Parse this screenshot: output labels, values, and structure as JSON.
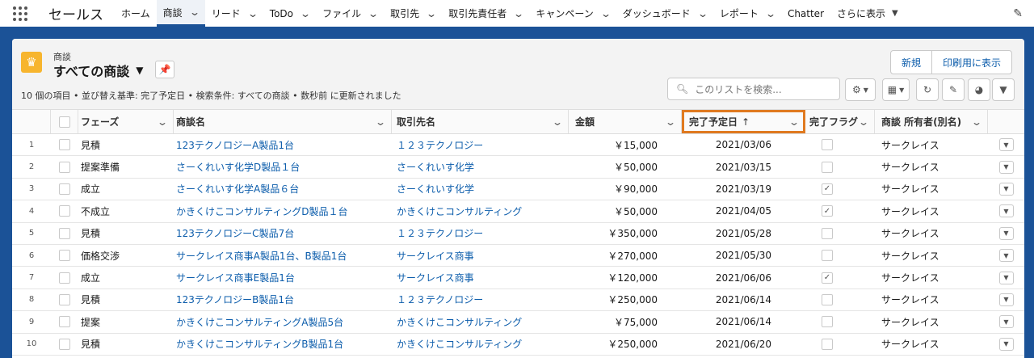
{
  "app": {
    "name": "セールス"
  },
  "nav": {
    "items": [
      {
        "label": "ホーム",
        "chevron": false
      },
      {
        "label": "商談",
        "chevron": true,
        "active": true
      },
      {
        "label": "リード",
        "chevron": true
      },
      {
        "label": "ToDo",
        "chevron": true
      },
      {
        "label": "ファイル",
        "chevron": true
      },
      {
        "label": "取引先",
        "chevron": true
      },
      {
        "label": "取引先責任者",
        "chevron": true
      },
      {
        "label": "キャンペーン",
        "chevron": true
      },
      {
        "label": "ダッシュボード",
        "chevron": true
      },
      {
        "label": "レポート",
        "chevron": true
      },
      {
        "label": "Chatter",
        "chevron": false
      }
    ],
    "more_label": "さらに表示"
  },
  "list": {
    "object_label": "商談",
    "title": "すべての商談",
    "meta": "10 個の項目 • 並び替え基準: 完了予定日 • 検索条件: すべての商談 • 数秒前 に更新されました",
    "new_label": "新規",
    "print_label": "印刷用に表示",
    "search_placeholder": "このリストを検索..."
  },
  "columns": {
    "phase": "フェーズ",
    "name": "商談名",
    "account": "取引先名",
    "amount": "金額",
    "close_date": "完了予定日",
    "close_date_arrow": "↑",
    "closed_flag": "完了フラグ",
    "owner": "商談 所有者(別名)"
  },
  "rows": [
    {
      "num": "1",
      "phase": "見積",
      "name": "123テクノロジーA製品1台",
      "account": "１２３テクノロジー",
      "amount": "￥15,000",
      "date": "2021/03/06",
      "closed": false,
      "owner": "サークレイス"
    },
    {
      "num": "2",
      "phase": "提案準備",
      "name": "さーくれいす化学D製品１台",
      "account": "さーくれいす化学",
      "amount": "￥50,000",
      "date": "2021/03/15",
      "closed": false,
      "owner": "サークレイス"
    },
    {
      "num": "3",
      "phase": "成立",
      "name": "さーくれいす化学A製品６台",
      "account": "さーくれいす化学",
      "amount": "￥90,000",
      "date": "2021/03/19",
      "closed": true,
      "owner": "サークレイス"
    },
    {
      "num": "4",
      "phase": "不成立",
      "name": "かきくけこコンサルティングD製品１台",
      "account": "かきくけこコンサルティング",
      "amount": "￥50,000",
      "date": "2021/04/05",
      "closed": true,
      "owner": "サークレイス"
    },
    {
      "num": "5",
      "phase": "見積",
      "name": "123テクノロジーC製品7台",
      "account": "１２３テクノロジー",
      "amount": "￥350,000",
      "date": "2021/05/28",
      "closed": false,
      "owner": "サークレイス"
    },
    {
      "num": "6",
      "phase": "価格交渉",
      "name": "サークレイス商事A製品1台、B製品1台",
      "account": "サークレイス商事",
      "amount": "￥270,000",
      "date": "2021/05/30",
      "closed": false,
      "owner": "サークレイス"
    },
    {
      "num": "7",
      "phase": "成立",
      "name": "サークレイス商事E製品1台",
      "account": "サークレイス商事",
      "amount": "￥120,000",
      "date": "2021/06/06",
      "closed": true,
      "owner": "サークレイス"
    },
    {
      "num": "8",
      "phase": "見積",
      "name": "123テクノロジーB製品1台",
      "account": "１２３テクノロジー",
      "amount": "￥250,000",
      "date": "2021/06/14",
      "closed": false,
      "owner": "サークレイス"
    },
    {
      "num": "9",
      "phase": "提案",
      "name": "かきくけこコンサルティングA製品5台",
      "account": "かきくけこコンサルティング",
      "amount": "￥75,000",
      "date": "2021/06/14",
      "closed": false,
      "owner": "サークレイス"
    },
    {
      "num": "10",
      "phase": "見積",
      "name": "かきくけこコンサルティングB製品1台",
      "account": "かきくけこコンサルティング",
      "amount": "￥250,000",
      "date": "2021/06/20",
      "closed": false,
      "owner": "サークレイス"
    }
  ],
  "icons": {
    "launcher": "app-launcher-icon",
    "object": "crown-icon",
    "pin": "pin-icon",
    "search": "search-icon",
    "settings": "gear-icon",
    "view": "table-view-icon",
    "refresh": "refresh-icon",
    "edit": "pencil-icon",
    "chart": "chart-icon",
    "filter": "filter-icon"
  },
  "colors": {
    "brand": "#1b5297",
    "link": "#0b5cab",
    "object_icon": "#f7b52e",
    "sort_highlight": "#e07a20"
  }
}
